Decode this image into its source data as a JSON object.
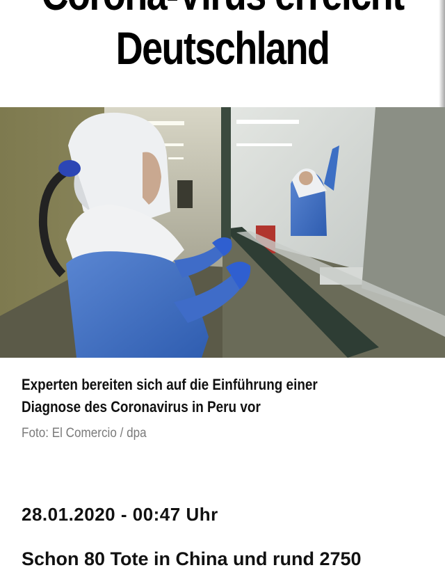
{
  "article": {
    "headline_line1": "Corona-Virus erreicht",
    "headline_line2": "Deutschland",
    "photo_caption": "Experten bereiten sich auf die Einführung einer Diagnose des Coronavirus in Peru vor",
    "photo_credit": "Foto: El Comercio / dpa",
    "date": "28.01.2020 - 00:47 Uhr",
    "teaser_partial": "Schon 80 Tote in China und rund 2750"
  },
  "colors": {
    "suit_blue": "#3d6fc4",
    "hood_white": "#eef0f2",
    "glove_blue": "#2f5fd0",
    "wall_olive": "#8f8a5c"
  },
  "icons": {
    "photo": "lab-worker-protective-suit-photo"
  }
}
